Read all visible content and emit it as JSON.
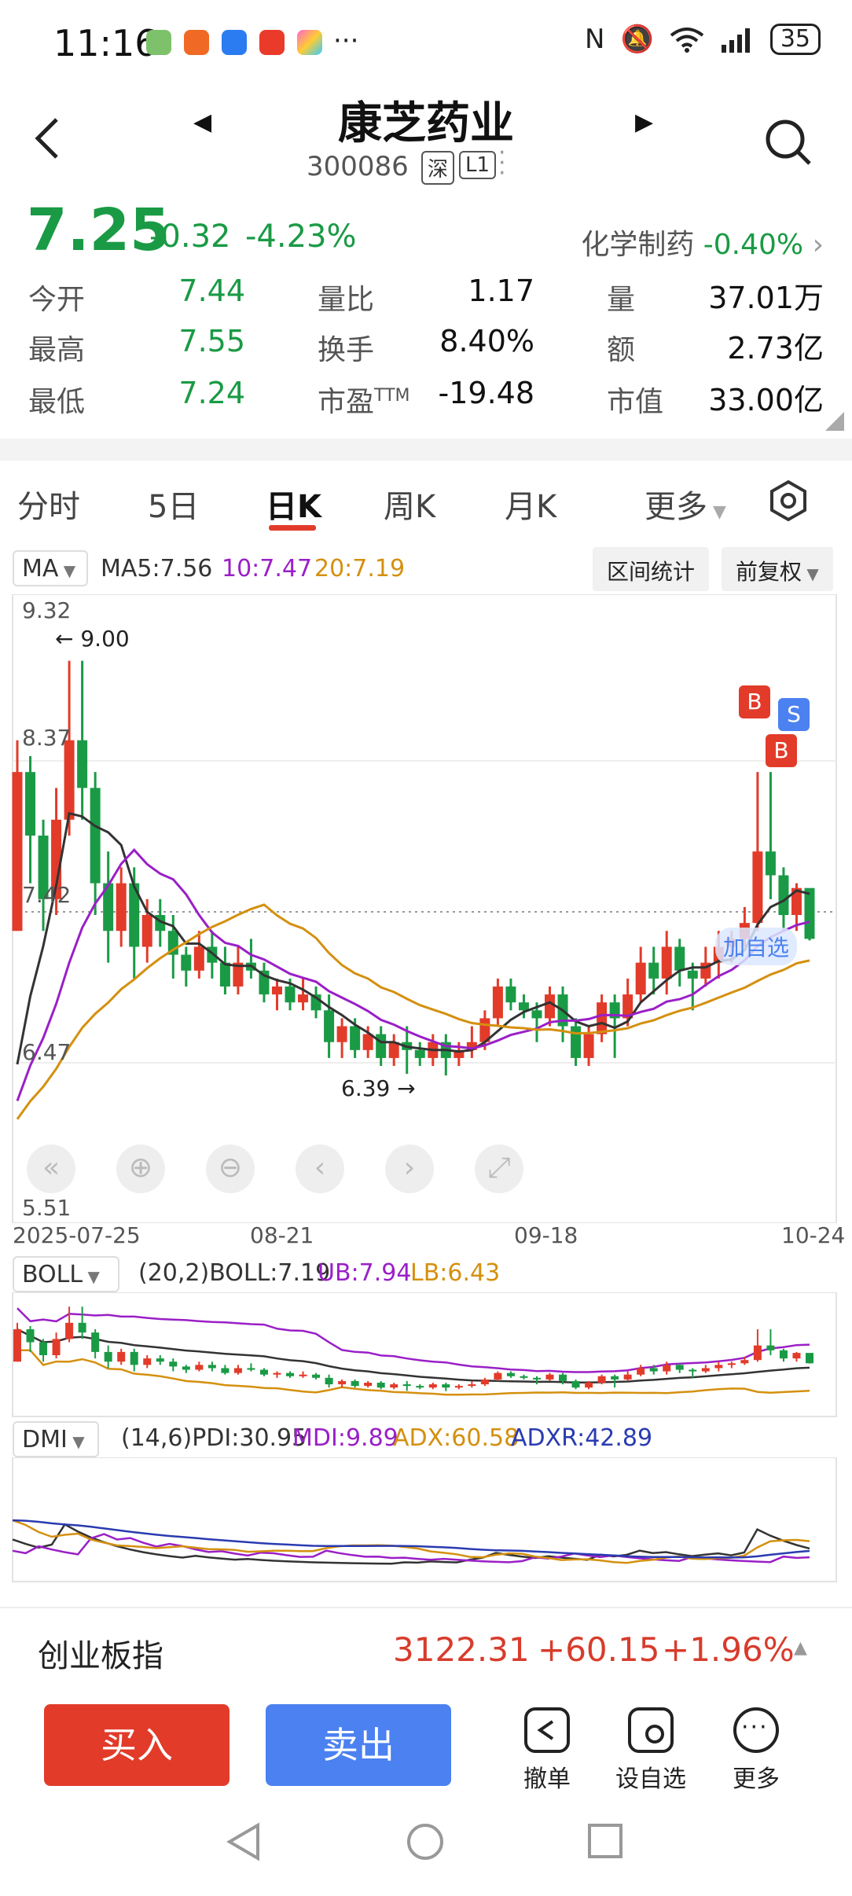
{
  "status_bar": {
    "time": "11:16",
    "battery": "35"
  },
  "header": {
    "title": "康芝药业",
    "code": "300086",
    "exchange_tag": "深",
    "level_tag": "L1"
  },
  "quote": {
    "price": "7.25",
    "change": "-0.32",
    "change_pct": "-4.23%",
    "sector_name": "化学制药",
    "sector_change": "-0.40%",
    "stats": [
      {
        "label": "今开",
        "value": "7.44"
      },
      {
        "label": "量比",
        "value": "1.17"
      },
      {
        "label": "量",
        "value": "37.01万"
      },
      {
        "label": "最高",
        "value": "7.55"
      },
      {
        "label": "换手",
        "value": "8.40%"
      },
      {
        "label": "额",
        "value": "2.73亿"
      },
      {
        "label": "最低",
        "value": "7.24"
      },
      {
        "label": "市盈TTM",
        "value": "-19.48"
      },
      {
        "label": "市值",
        "value": "33.00亿"
      }
    ]
  },
  "tabs": [
    {
      "label": "分时"
    },
    {
      "label": "5日"
    },
    {
      "label": "日K"
    },
    {
      "label": "周K"
    },
    {
      "label": "月K"
    },
    {
      "label": "更多"
    }
  ],
  "chart_controls": {
    "indicator": "MA",
    "ma5": "MA5:7.56",
    "ma10": "10:7.47",
    "ma20": "20:7.19",
    "range_stats": "区间统计",
    "adjust": "前复权"
  },
  "chart_data": {
    "type": "candlestick",
    "y_ticks": [
      "9.32",
      "8.37",
      "7.42",
      "6.47",
      "5.51"
    ],
    "ylim": [
      5.51,
      9.32
    ],
    "x_labels": [
      "2025-07-25",
      "08-21",
      "09-18",
      "10-24"
    ],
    "annotations": {
      "high": "← 9.00",
      "low": "6.39 →",
      "add_watch": "加自选",
      "buy_mark": "B",
      "sell_mark": "S"
    },
    "candles": [
      [
        7.3,
        8.3,
        8.5,
        7.3
      ],
      [
        8.3,
        7.9,
        8.4,
        7.6
      ],
      [
        7.9,
        7.5,
        8.0,
        7.3
      ],
      [
        7.5,
        8.0,
        8.2,
        7.4
      ],
      [
        8.0,
        8.5,
        9.0,
        7.9
      ],
      [
        8.5,
        8.2,
        9.0,
        8.0
      ],
      [
        8.2,
        7.6,
        8.3,
        7.4
      ],
      [
        7.6,
        7.3,
        7.8,
        7.1
      ],
      [
        7.3,
        7.6,
        7.7,
        7.2
      ],
      [
        7.6,
        7.2,
        7.7,
        7.0
      ],
      [
        7.2,
        7.4,
        7.5,
        7.1
      ],
      [
        7.4,
        7.3,
        7.5,
        7.2
      ],
      [
        7.3,
        7.15,
        7.4,
        7.0
      ],
      [
        7.15,
        7.05,
        7.2,
        6.95
      ],
      [
        7.05,
        7.2,
        7.3,
        7.0
      ],
      [
        7.2,
        7.1,
        7.3,
        7.0
      ],
      [
        7.1,
        6.95,
        7.2,
        6.9
      ],
      [
        6.95,
        7.1,
        7.2,
        6.9
      ],
      [
        7.1,
        7.05,
        7.25,
        7.0
      ],
      [
        7.05,
        6.9,
        7.1,
        6.85
      ],
      [
        6.9,
        6.95,
        7.0,
        6.8
      ],
      [
        6.95,
        6.85,
        7.0,
        6.8
      ],
      [
        6.85,
        6.9,
        7.0,
        6.8
      ],
      [
        6.9,
        6.8,
        6.95,
        6.75
      ],
      [
        6.8,
        6.6,
        6.9,
        6.5
      ],
      [
        6.6,
        6.7,
        6.75,
        6.5
      ],
      [
        6.7,
        6.55,
        6.75,
        6.5
      ],
      [
        6.55,
        6.65,
        6.7,
        6.5
      ],
      [
        6.65,
        6.5,
        6.7,
        6.45
      ],
      [
        6.5,
        6.6,
        6.65,
        6.45
      ],
      [
        6.6,
        6.55,
        6.7,
        6.4
      ],
      [
        6.55,
        6.5,
        6.6,
        6.45
      ],
      [
        6.5,
        6.6,
        6.65,
        6.45
      ],
      [
        6.6,
        6.5,
        6.65,
        6.39
      ],
      [
        6.5,
        6.55,
        6.6,
        6.45
      ],
      [
        6.55,
        6.6,
        6.7,
        6.5
      ],
      [
        6.6,
        6.75,
        6.8,
        6.55
      ],
      [
        6.75,
        6.95,
        7.0,
        6.7
      ],
      [
        6.95,
        6.85,
        7.0,
        6.8
      ],
      [
        6.85,
        6.8,
        6.9,
        6.75
      ],
      [
        6.8,
        6.75,
        6.85,
        6.6
      ],
      [
        6.75,
        6.9,
        6.95,
        6.7
      ],
      [
        6.9,
        6.7,
        6.95,
        6.6
      ],
      [
        6.7,
        6.5,
        6.75,
        6.45
      ],
      [
        6.5,
        6.65,
        6.7,
        6.45
      ],
      [
        6.65,
        6.85,
        6.9,
        6.6
      ],
      [
        6.85,
        6.75,
        6.9,
        6.5
      ],
      [
        6.75,
        6.9,
        7.0,
        6.7
      ],
      [
        6.9,
        7.1,
        7.2,
        6.85
      ],
      [
        7.1,
        7.0,
        7.2,
        6.9
      ],
      [
        7.0,
        7.2,
        7.3,
        6.9
      ],
      [
        7.2,
        7.05,
        7.25,
        6.95
      ],
      [
        7.05,
        7.0,
        7.1,
        6.8
      ],
      [
        7.0,
        7.1,
        7.2,
        6.95
      ],
      [
        7.1,
        7.2,
        7.3,
        7.0
      ],
      [
        7.2,
        7.25,
        7.3,
        7.1
      ],
      [
        7.25,
        7.35,
        7.45,
        7.2
      ],
      [
        7.35,
        7.8,
        8.3,
        7.3
      ],
      [
        7.8,
        7.65,
        8.3,
        7.5
      ],
      [
        7.65,
        7.4,
        7.7,
        7.3
      ],
      [
        7.4,
        7.57,
        7.6,
        7.3
      ],
      [
        7.57,
        7.25,
        7.55,
        7.24
      ]
    ]
  },
  "boll": {
    "label": "BOLL",
    "params": "(20,2)BOLL:7.19",
    "ub": "UB:7.94",
    "lb": "LB:6.43"
  },
  "dmi": {
    "label": "DMI",
    "params": "(14,6)PDI:30.95",
    "mdi": "MDI:9.89",
    "adx": "ADX:60.58",
    "adxr": "ADXR:42.89"
  },
  "index": {
    "name": "创业板指",
    "value": "3122.31",
    "change": "+60.15",
    "change_pct": "+1.96%"
  },
  "actions": {
    "buy": "买入",
    "sell": "卖出",
    "cancel": "撤单",
    "set_watch": "设自选",
    "more": "更多"
  },
  "colors": {
    "up": "#e23b2a",
    "down": "#1a9a45",
    "ma5": "#333333",
    "ma10": "#9a1fc7",
    "ma20": "#d4900f",
    "sell_blue": "#4b81f0"
  }
}
